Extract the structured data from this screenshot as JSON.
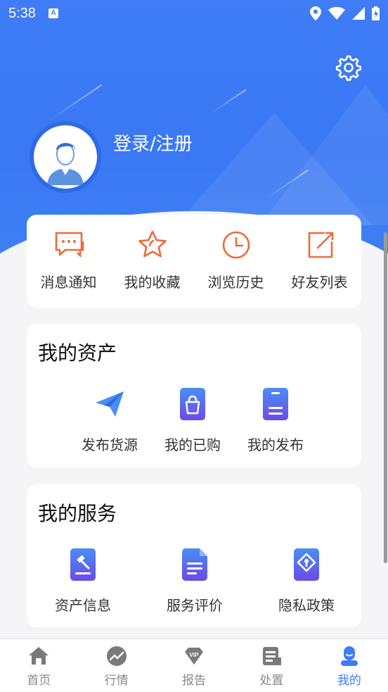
{
  "status_bar": {
    "time": "5:38",
    "notification_icon": "A"
  },
  "header": {
    "login_text": "登录/注册"
  },
  "quick_actions": [
    {
      "label": "消息通知",
      "icon": "message-icon"
    },
    {
      "label": "我的收藏",
      "icon": "star-icon"
    },
    {
      "label": "浏览历史",
      "icon": "clock-icon"
    },
    {
      "label": "好友列表",
      "icon": "share-icon"
    }
  ],
  "assets": {
    "title": "我的资产",
    "items": [
      {
        "label": "发布货源",
        "icon": "paper-plane-icon"
      },
      {
        "label": "我的已购",
        "icon": "shopping-bag-icon"
      },
      {
        "label": "我的发布",
        "icon": "document-icon"
      }
    ]
  },
  "services": {
    "title": "我的服务",
    "items": [
      {
        "label": "资产信息",
        "icon": "gavel-icon"
      },
      {
        "label": "服务评价",
        "icon": "file-text-icon"
      },
      {
        "label": "隐私政策",
        "icon": "privacy-icon"
      }
    ]
  },
  "bottom_nav": [
    {
      "label": "首页",
      "icon": "home-icon"
    },
    {
      "label": "行情",
      "icon": "trend-icon"
    },
    {
      "label": "报告",
      "icon": "vip-icon"
    },
    {
      "label": "处置",
      "icon": "list-icon"
    },
    {
      "label": "我的",
      "icon": "user-icon",
      "active": true
    }
  ],
  "colors": {
    "primary": "#3f7cf6",
    "accent_orange": "#ef6a3a",
    "nav_inactive": "#888888"
  }
}
